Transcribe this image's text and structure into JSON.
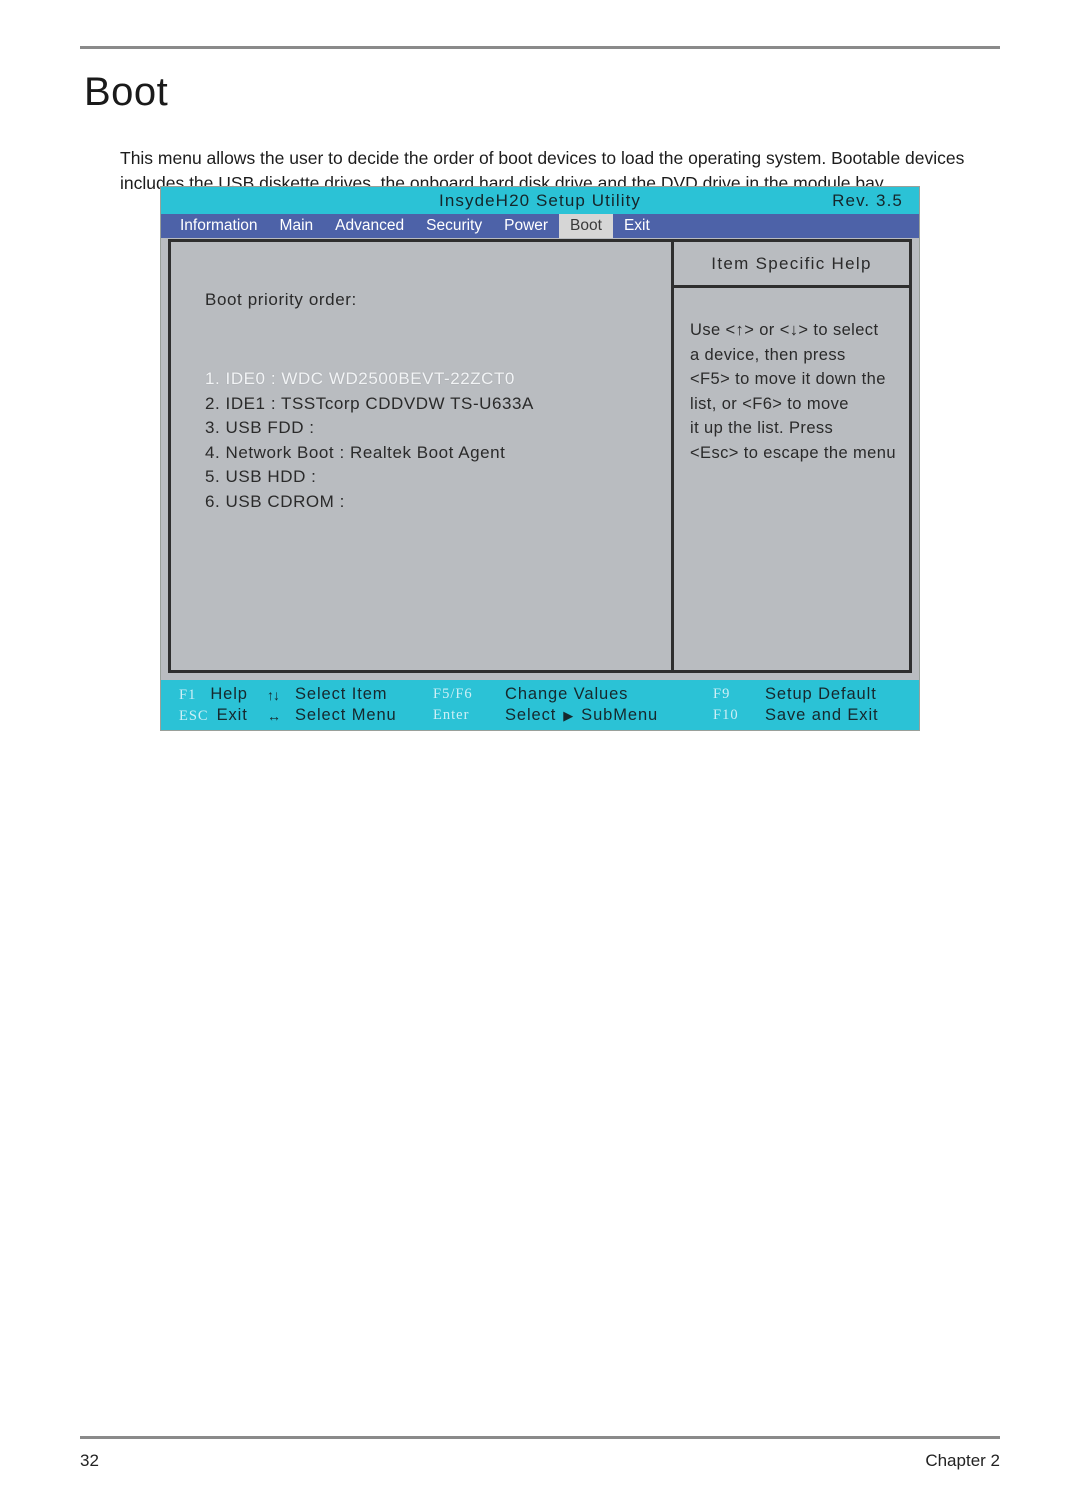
{
  "document": {
    "title": "Boot",
    "intro": "This menu allows the user to decide the order of boot devices to load the operating system. Bootable devices includes the USB diskette drives, the onboard hard disk drive and the DVD drive in the module bay.",
    "footer_page": "32",
    "footer_chapter": "Chapter 2"
  },
  "bios": {
    "title": "InsydeH20 Setup Utility",
    "revision": "Rev. 3.5",
    "menu": [
      {
        "label": "Information",
        "active": false
      },
      {
        "label": "Main",
        "active": false
      },
      {
        "label": "Advanced",
        "active": false
      },
      {
        "label": "Security",
        "active": false
      },
      {
        "label": "Power",
        "active": false
      },
      {
        "label": "Boot",
        "active": true
      },
      {
        "label": "Exit",
        "active": false
      }
    ],
    "boot_order_label": "Boot priority order:",
    "boot_items": [
      {
        "text": "1. IDE0 : WDC WD2500BEVT-22ZCT0",
        "selected": true
      },
      {
        "text": "2. IDE1 : TSSTcorp CDDVDW TS-U633A",
        "selected": false
      },
      {
        "text": "3. USB FDD :",
        "selected": false
      },
      {
        "text": "4. Network Boot : Realtek Boot Agent",
        "selected": false
      },
      {
        "text": "5. USB HDD :",
        "selected": false
      },
      {
        "text": "6. USB CDROM :",
        "selected": false
      }
    ],
    "help": {
      "title": "Item Specific Help",
      "lines": [
        "Use <↑> or <↓> to select",
        "a device, then press",
        "<F5> to move it down the",
        "list, or <F6> to move",
        "it up the list. Press",
        "<Esc> to escape the menu"
      ]
    },
    "function_bar": {
      "row1": {
        "key1": "F1",
        "desc1": "Help",
        "arrow1": "↑↓",
        "desc2": "Select Item",
        "key2": "F5/F6",
        "desc3": "Change Values",
        "key3": "F9",
        "desc4": "Setup Default"
      },
      "row2": {
        "key1": "ESC",
        "desc1": "Exit",
        "arrow1": "↔",
        "desc2": "Select Menu",
        "key2": "Enter",
        "desc3a": "Select",
        "submenu_arrow": "▶",
        "desc3b": "SubMenu",
        "key3": "F10",
        "desc4": "Save and Exit"
      }
    },
    "colors": {
      "titlebar": "#2bc2d6",
      "menubar": "#4d62a8",
      "active_tab": "#d6d6d6",
      "panel": "#b9bcc0",
      "border": "#2e2e2e"
    }
  }
}
